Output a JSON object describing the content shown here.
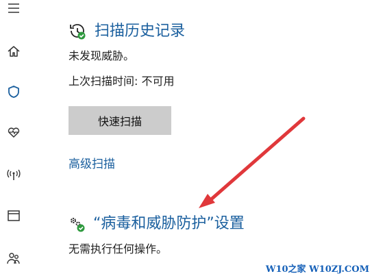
{
  "scan_history": {
    "title": "扫描历史记录",
    "status": "未发现威胁。",
    "last_scan": "上次扫描时间: 不可用",
    "quick_scan_button": "快速扫描",
    "advanced_scan_link": "高级扫描"
  },
  "virus_settings": {
    "title": "“病毒和威胁防护”设置",
    "status": "无需执行任何操作。"
  },
  "sidebar": {
    "icons": [
      "menu-icon",
      "home-icon",
      "shield-icon",
      "health-icon",
      "network-icon",
      "browser-icon",
      "family-icon"
    ]
  },
  "watermark": "W10之家 W10ZJ.COM",
  "colors": {
    "accent": "#1a5f9e",
    "annotation_arrow": "#e0383b",
    "check_green": "#2e9a3e"
  }
}
